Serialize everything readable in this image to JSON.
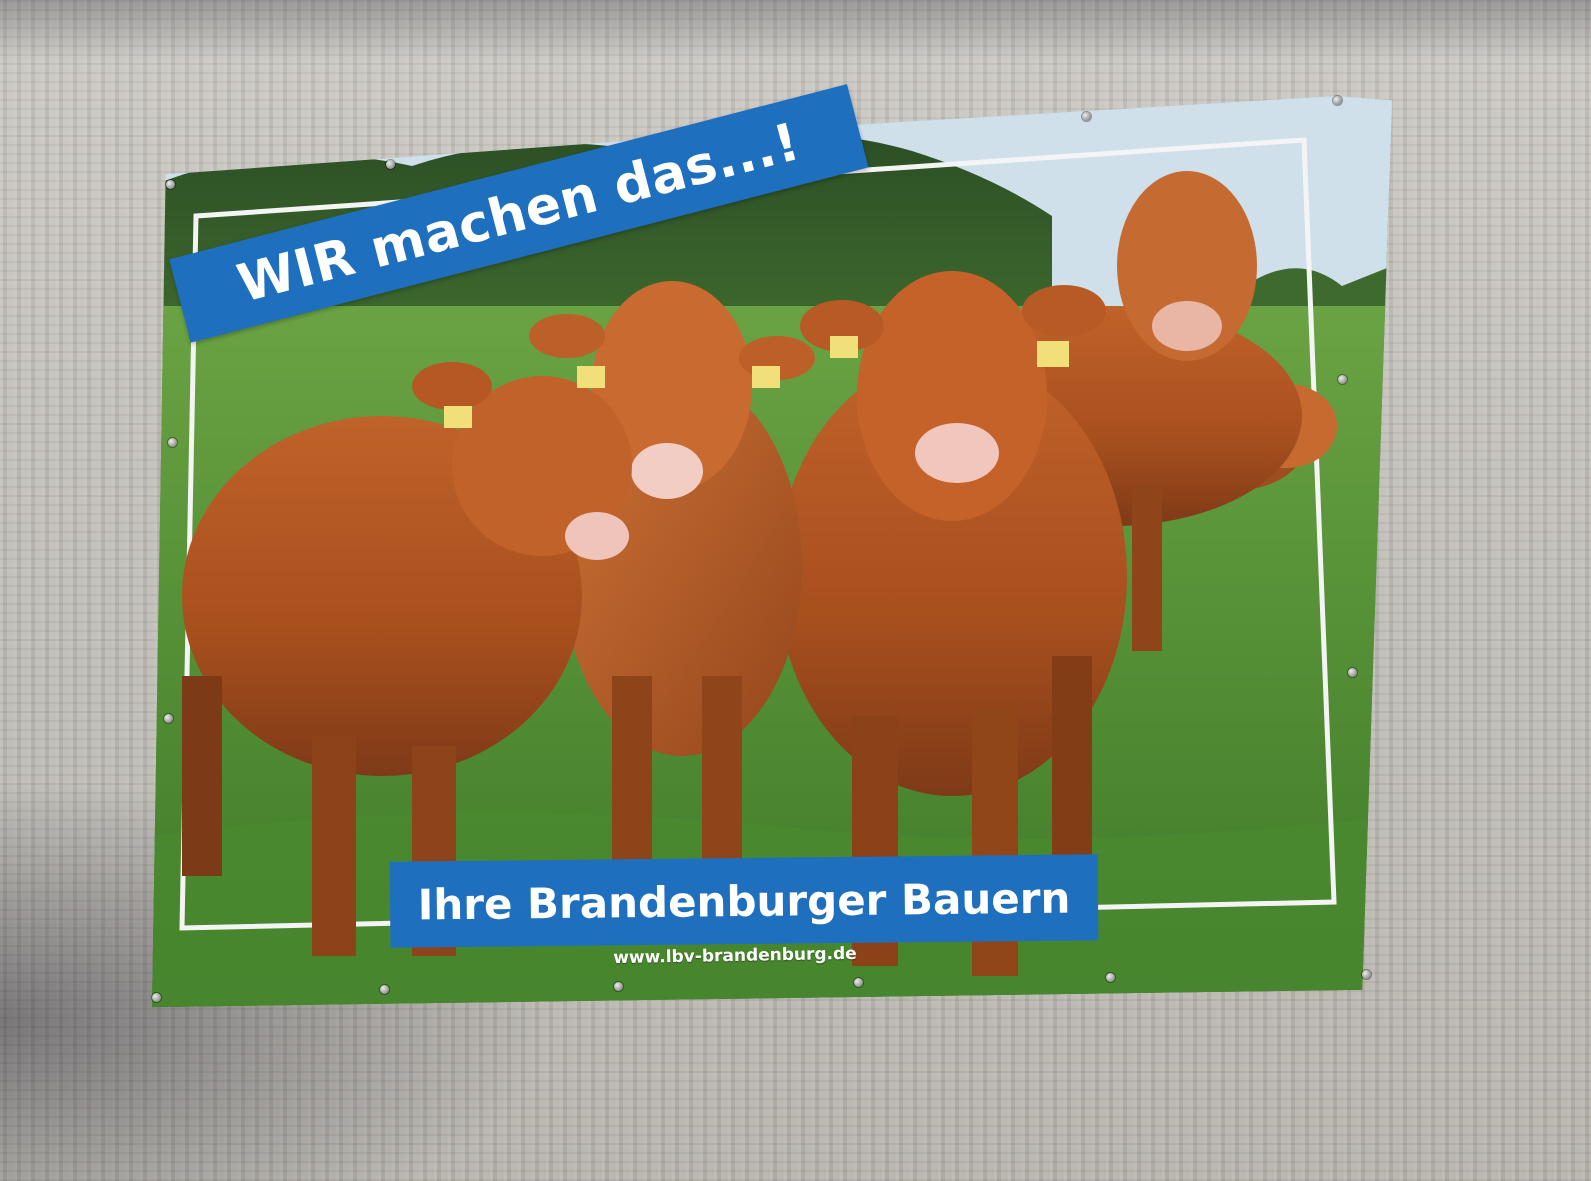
{
  "poster": {
    "headline": "WIR machen das...!",
    "tagline": "Ihre Brandenburger Bauern",
    "url": "www.lbv-brandenburg.de",
    "accent_color": "#1f6fbf",
    "subject": "herd of brown cattle on grass pasture"
  }
}
